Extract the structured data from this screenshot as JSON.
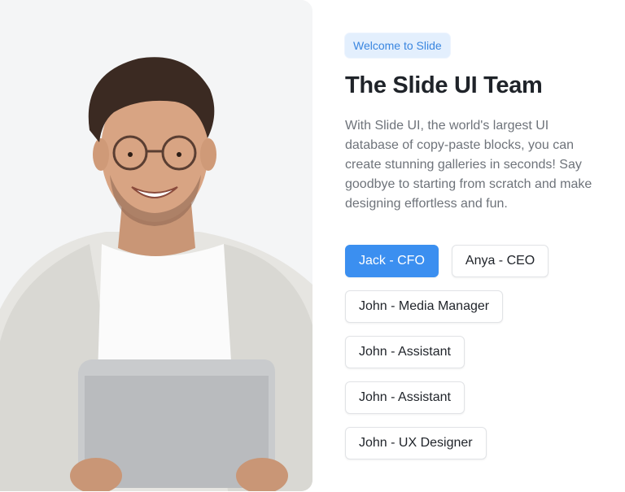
{
  "badge": "Welcome to Slide",
  "title": "The Slide UI Team",
  "description": "With Slide UI, the world's largest UI database of copy-paste blocks, you can create stunning galleries in seconds! Say goodbye to starting from scratch and make designing effortless and fun.",
  "team_buttons": [
    {
      "label": "Jack - CFO",
      "active": true
    },
    {
      "label": "Anya - CEO",
      "active": false
    },
    {
      "label": "John - Media Manager",
      "active": false
    },
    {
      "label": "John - Assistant",
      "active": false
    },
    {
      "label": "John - Assistant",
      "active": false
    },
    {
      "label": "John - UX Designer",
      "active": false
    }
  ],
  "colors": {
    "accent": "#3b8ff0",
    "badge_bg": "#e3effd",
    "badge_text": "#3a86e0",
    "title": "#1f2329",
    "body_text": "#6e737a"
  }
}
